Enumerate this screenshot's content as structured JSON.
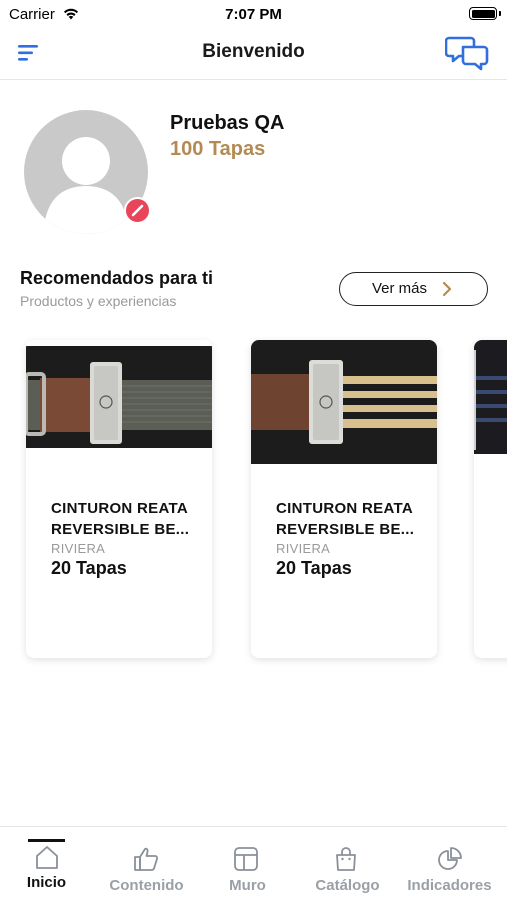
{
  "status_bar": {
    "carrier": "Carrier",
    "time": "7:07 PM"
  },
  "header": {
    "title": "Bienvenido",
    "menu_icon": "hamburger-icon",
    "chat_icon": "chat-bubbles-icon",
    "accent_color": "#2f6fe0"
  },
  "profile": {
    "name": "Pruebas QA",
    "points": "100 Tapas",
    "points_color": "#b48a53",
    "status_color": "#e8455a"
  },
  "recommendations": {
    "title": "Recomendados para ti",
    "subtitle": "Productos y experiencias",
    "more_label": "Ver más",
    "items": [
      {
        "name": "CINTURON REATA REVERSIBLE BE...",
        "brand": "RIVIERA",
        "price": "20 Tapas"
      },
      {
        "name": "CINTURON REATA REVERSIBLE BE...",
        "brand": "RIVIERA",
        "price": "20 Tapas"
      }
    ]
  },
  "tabbar": {
    "tabs": [
      {
        "label": "Inicio",
        "icon": "home-icon",
        "active": true
      },
      {
        "label": "Contenido",
        "icon": "thumbs-up-icon",
        "active": false
      },
      {
        "label": "Muro",
        "icon": "wall-icon",
        "active": false
      },
      {
        "label": "Catálogo",
        "icon": "shopping-bag-icon",
        "active": false
      },
      {
        "label": "Indicadores",
        "icon": "pie-chart-icon",
        "active": false
      }
    ]
  }
}
